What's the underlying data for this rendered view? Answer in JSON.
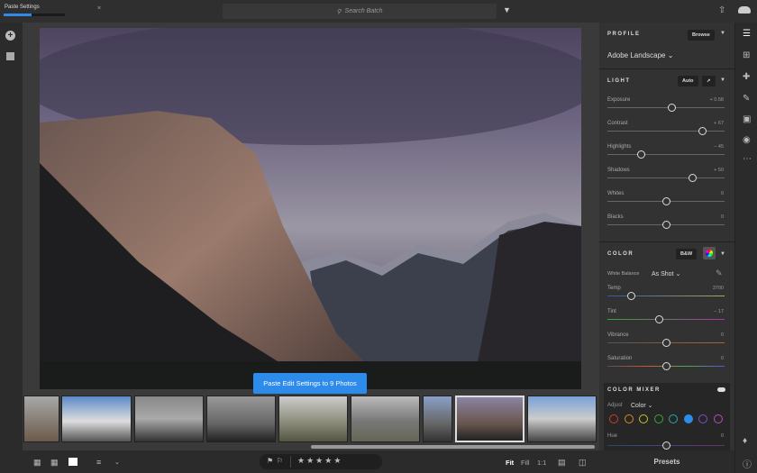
{
  "topbar": {
    "progress_label": "Paste Settings",
    "progress": 0.45,
    "close": "×",
    "search_placeholder": "Search Batch"
  },
  "photo_action": {
    "paste_label": "Paste Edit Settings to 9 Photos"
  },
  "filmstrip": {
    "count": 9,
    "selected": 7
  },
  "bottombar": {
    "fit": "Fit",
    "fill": "Fill",
    "one_to_one": "1:1",
    "rating_stars": [
      "★",
      "★",
      "★",
      "★",
      "★"
    ]
  },
  "profile": {
    "title": "PROFILE",
    "browse": "Browse",
    "value": "Adobe Landscape"
  },
  "light": {
    "title": "LIGHT",
    "auto": "Auto",
    "sliders": [
      {
        "label": "Exposure",
        "value": "+ 0.58",
        "pos": 0.55
      },
      {
        "label": "Contrast",
        "value": "+ 67",
        "pos": 0.81
      },
      {
        "label": "Highlights",
        "value": "− 45",
        "pos": 0.29
      },
      {
        "label": "Shadows",
        "value": "+ 50",
        "pos": 0.73
      },
      {
        "label": "Whites",
        "value": "0",
        "pos": 0.5
      },
      {
        "label": "Blacks",
        "value": "0",
        "pos": 0.5
      }
    ]
  },
  "color": {
    "title": "COLOR",
    "bw": "B&W",
    "white_balance_label": "White Balance",
    "white_balance_value": "As Shot",
    "sliders": [
      {
        "label": "Temp",
        "value": "3700",
        "pos": 0.2
      },
      {
        "label": "Tint",
        "value": "− 17",
        "pos": 0.44
      },
      {
        "label": "Vibrance",
        "value": "0",
        "pos": 0.5
      },
      {
        "label": "Saturation",
        "value": "0",
        "pos": 0.5
      }
    ]
  },
  "color_mixer": {
    "title": "COLOR MIXER",
    "adjust_label": "Adjust",
    "adjust_value": "Color",
    "swatches": [
      "#d13b2e",
      "#d98a25",
      "#c9c22a",
      "#3aa83a",
      "#2fa7a7",
      "#2d8ceb",
      "#7b4fd1",
      "#b54fc1"
    ],
    "selected_swatch": 5,
    "hue_label": "Hue",
    "hue_value": "0",
    "hue_pos": 0.5
  },
  "presets_label": "Presets",
  "colors": {
    "accent": "#2d8ceb"
  }
}
